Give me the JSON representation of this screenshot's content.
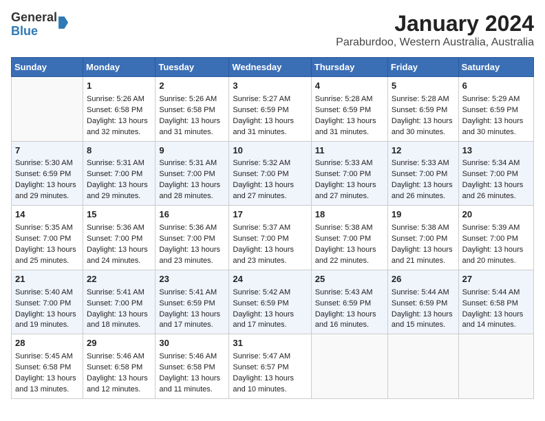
{
  "logo": {
    "line1": "General",
    "line2": "Blue"
  },
  "title": "January 2024",
  "subtitle": "Paraburdoo, Western Australia, Australia",
  "headers": [
    "Sunday",
    "Monday",
    "Tuesday",
    "Wednesday",
    "Thursday",
    "Friday",
    "Saturday"
  ],
  "weeks": [
    [
      {
        "day": "",
        "sunrise": "",
        "sunset": "",
        "daylight": ""
      },
      {
        "day": "1",
        "sunrise": "Sunrise: 5:26 AM",
        "sunset": "Sunset: 6:58 PM",
        "daylight": "Daylight: 13 hours and 32 minutes."
      },
      {
        "day": "2",
        "sunrise": "Sunrise: 5:26 AM",
        "sunset": "Sunset: 6:58 PM",
        "daylight": "Daylight: 13 hours and 31 minutes."
      },
      {
        "day": "3",
        "sunrise": "Sunrise: 5:27 AM",
        "sunset": "Sunset: 6:59 PM",
        "daylight": "Daylight: 13 hours and 31 minutes."
      },
      {
        "day": "4",
        "sunrise": "Sunrise: 5:28 AM",
        "sunset": "Sunset: 6:59 PM",
        "daylight": "Daylight: 13 hours and 31 minutes."
      },
      {
        "day": "5",
        "sunrise": "Sunrise: 5:28 AM",
        "sunset": "Sunset: 6:59 PM",
        "daylight": "Daylight: 13 hours and 30 minutes."
      },
      {
        "day": "6",
        "sunrise": "Sunrise: 5:29 AM",
        "sunset": "Sunset: 6:59 PM",
        "daylight": "Daylight: 13 hours and 30 minutes."
      }
    ],
    [
      {
        "day": "7",
        "sunrise": "Sunrise: 5:30 AM",
        "sunset": "Sunset: 6:59 PM",
        "daylight": "Daylight: 13 hours and 29 minutes."
      },
      {
        "day": "8",
        "sunrise": "Sunrise: 5:31 AM",
        "sunset": "Sunset: 7:00 PM",
        "daylight": "Daylight: 13 hours and 29 minutes."
      },
      {
        "day": "9",
        "sunrise": "Sunrise: 5:31 AM",
        "sunset": "Sunset: 7:00 PM",
        "daylight": "Daylight: 13 hours and 28 minutes."
      },
      {
        "day": "10",
        "sunrise": "Sunrise: 5:32 AM",
        "sunset": "Sunset: 7:00 PM",
        "daylight": "Daylight: 13 hours and 27 minutes."
      },
      {
        "day": "11",
        "sunrise": "Sunrise: 5:33 AM",
        "sunset": "Sunset: 7:00 PM",
        "daylight": "Daylight: 13 hours and 27 minutes."
      },
      {
        "day": "12",
        "sunrise": "Sunrise: 5:33 AM",
        "sunset": "Sunset: 7:00 PM",
        "daylight": "Daylight: 13 hours and 26 minutes."
      },
      {
        "day": "13",
        "sunrise": "Sunrise: 5:34 AM",
        "sunset": "Sunset: 7:00 PM",
        "daylight": "Daylight: 13 hours and 26 minutes."
      }
    ],
    [
      {
        "day": "14",
        "sunrise": "Sunrise: 5:35 AM",
        "sunset": "Sunset: 7:00 PM",
        "daylight": "Daylight: 13 hours and 25 minutes."
      },
      {
        "day": "15",
        "sunrise": "Sunrise: 5:36 AM",
        "sunset": "Sunset: 7:00 PM",
        "daylight": "Daylight: 13 hours and 24 minutes."
      },
      {
        "day": "16",
        "sunrise": "Sunrise: 5:36 AM",
        "sunset": "Sunset: 7:00 PM",
        "daylight": "Daylight: 13 hours and 23 minutes."
      },
      {
        "day": "17",
        "sunrise": "Sunrise: 5:37 AM",
        "sunset": "Sunset: 7:00 PM",
        "daylight": "Daylight: 13 hours and 23 minutes."
      },
      {
        "day": "18",
        "sunrise": "Sunrise: 5:38 AM",
        "sunset": "Sunset: 7:00 PM",
        "daylight": "Daylight: 13 hours and 22 minutes."
      },
      {
        "day": "19",
        "sunrise": "Sunrise: 5:38 AM",
        "sunset": "Sunset: 7:00 PM",
        "daylight": "Daylight: 13 hours and 21 minutes."
      },
      {
        "day": "20",
        "sunrise": "Sunrise: 5:39 AM",
        "sunset": "Sunset: 7:00 PM",
        "daylight": "Daylight: 13 hours and 20 minutes."
      }
    ],
    [
      {
        "day": "21",
        "sunrise": "Sunrise: 5:40 AM",
        "sunset": "Sunset: 7:00 PM",
        "daylight": "Daylight: 13 hours and 19 minutes."
      },
      {
        "day": "22",
        "sunrise": "Sunrise: 5:41 AM",
        "sunset": "Sunset: 7:00 PM",
        "daylight": "Daylight: 13 hours and 18 minutes."
      },
      {
        "day": "23",
        "sunrise": "Sunrise: 5:41 AM",
        "sunset": "Sunset: 6:59 PM",
        "daylight": "Daylight: 13 hours and 17 minutes."
      },
      {
        "day": "24",
        "sunrise": "Sunrise: 5:42 AM",
        "sunset": "Sunset: 6:59 PM",
        "daylight": "Daylight: 13 hours and 17 minutes."
      },
      {
        "day": "25",
        "sunrise": "Sunrise: 5:43 AM",
        "sunset": "Sunset: 6:59 PM",
        "daylight": "Daylight: 13 hours and 16 minutes."
      },
      {
        "day": "26",
        "sunrise": "Sunrise: 5:44 AM",
        "sunset": "Sunset: 6:59 PM",
        "daylight": "Daylight: 13 hours and 15 minutes."
      },
      {
        "day": "27",
        "sunrise": "Sunrise: 5:44 AM",
        "sunset": "Sunset: 6:58 PM",
        "daylight": "Daylight: 13 hours and 14 minutes."
      }
    ],
    [
      {
        "day": "28",
        "sunrise": "Sunrise: 5:45 AM",
        "sunset": "Sunset: 6:58 PM",
        "daylight": "Daylight: 13 hours and 13 minutes."
      },
      {
        "day": "29",
        "sunrise": "Sunrise: 5:46 AM",
        "sunset": "Sunset: 6:58 PM",
        "daylight": "Daylight: 13 hours and 12 minutes."
      },
      {
        "day": "30",
        "sunrise": "Sunrise: 5:46 AM",
        "sunset": "Sunset: 6:58 PM",
        "daylight": "Daylight: 13 hours and 11 minutes."
      },
      {
        "day": "31",
        "sunrise": "Sunrise: 5:47 AM",
        "sunset": "Sunset: 6:57 PM",
        "daylight": "Daylight: 13 hours and 10 minutes."
      },
      {
        "day": "",
        "sunrise": "",
        "sunset": "",
        "daylight": ""
      },
      {
        "day": "",
        "sunrise": "",
        "sunset": "",
        "daylight": ""
      },
      {
        "day": "",
        "sunrise": "",
        "sunset": "",
        "daylight": ""
      }
    ]
  ]
}
